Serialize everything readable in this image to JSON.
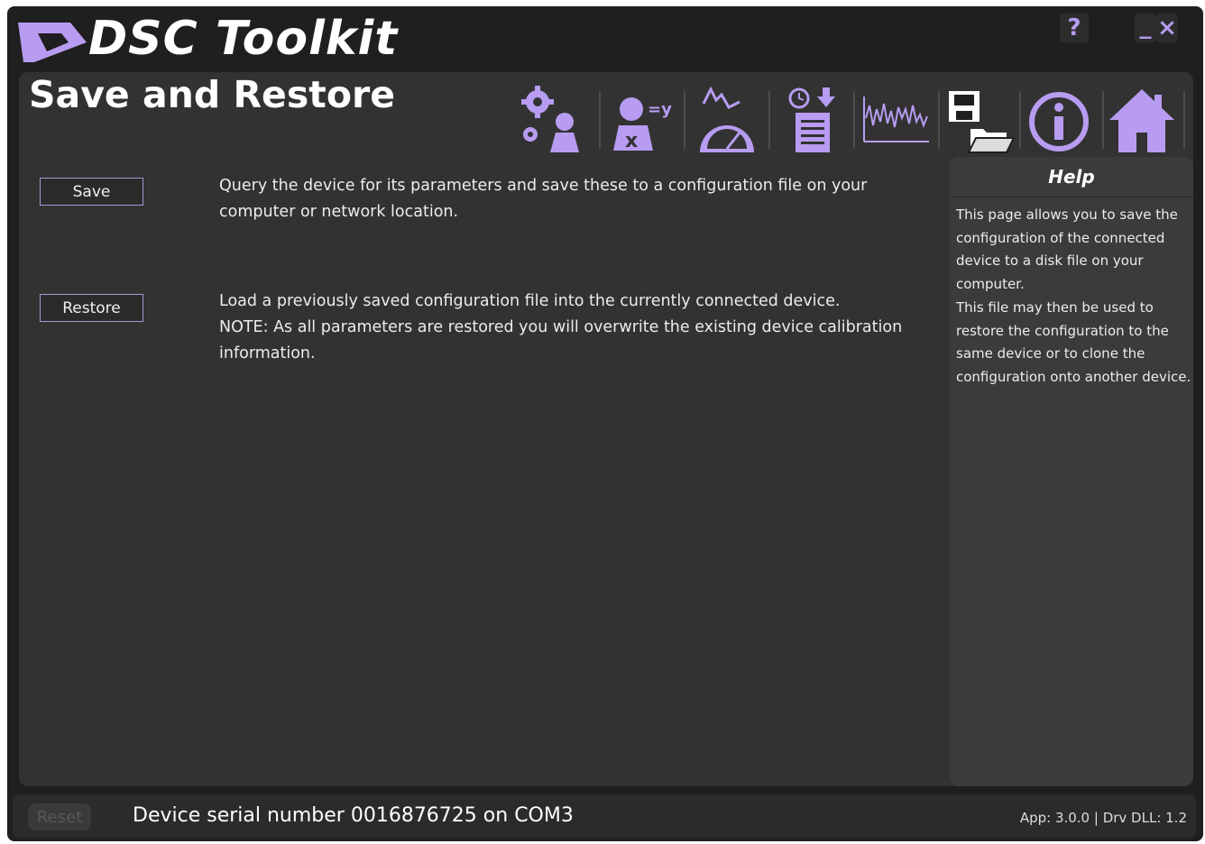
{
  "app": {
    "title": "DSC Toolkit",
    "help_button": "?",
    "minimize_button": "_",
    "close_button": "×"
  },
  "page": {
    "title": "Save and Restore"
  },
  "toolbar": {
    "items": [
      {
        "icon": "settings-user-icon"
      },
      {
        "icon": "scaling-icon"
      },
      {
        "icon": "gauge-icon"
      },
      {
        "icon": "logging-icon"
      },
      {
        "icon": "waveform-icon"
      },
      {
        "icon": "save-restore-icon"
      },
      {
        "icon": "info-icon"
      },
      {
        "icon": "home-icon"
      }
    ]
  },
  "actions": {
    "save": {
      "label": "Save",
      "description": "Query the device for its parameters and save these to a configuration file on your computer or network location."
    },
    "restore": {
      "label": "Restore",
      "description_line1": "Load a previously saved configuration file into the currently connected device.",
      "description_line2": "NOTE: As all parameters are restored you will overwrite the existing device calibration information."
    }
  },
  "help": {
    "title": "Help",
    "paragraph1": "This page allows you to save the configuration of the connected device to a disk file on your computer.",
    "paragraph2": "This file may then be used to restore the configuration to the same device or to clone the configuration onto another device."
  },
  "status": {
    "reset_label": "Reset",
    "device_serial": "Device serial number 0016876725 on COM3",
    "versions": "App: 3.0.0 | Drv DLL: 1.2"
  },
  "colors": {
    "accent": "#b79cf1",
    "background": "#1f1f1f",
    "panel": "#323232",
    "help_panel": "#3b3b3b"
  }
}
